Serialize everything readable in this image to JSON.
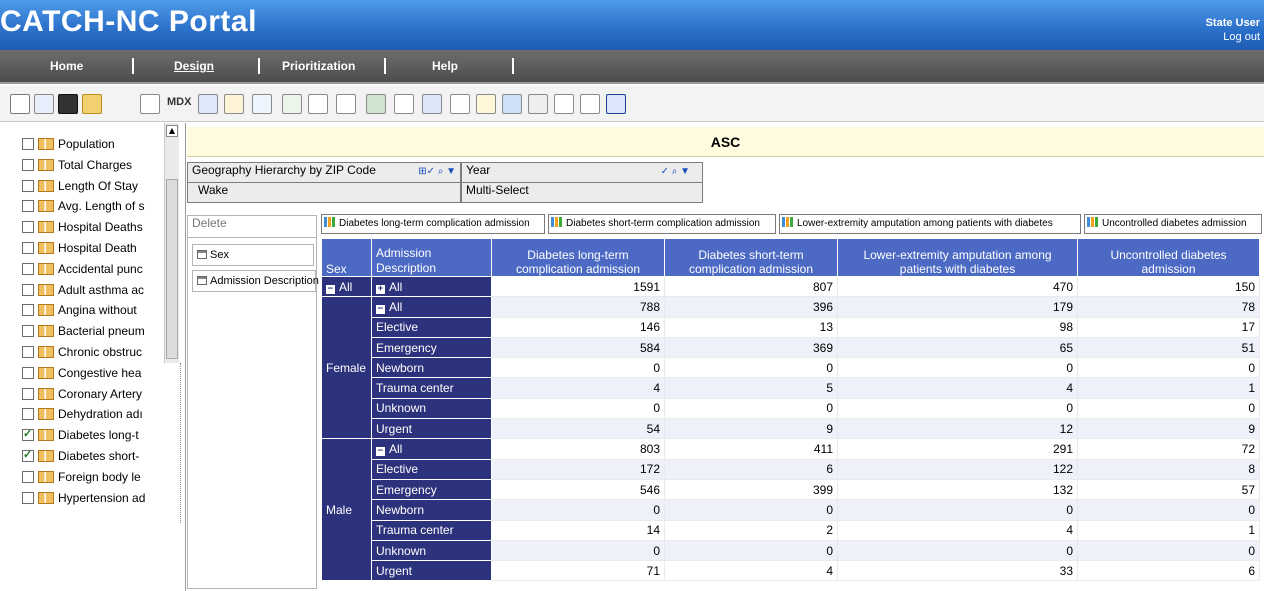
{
  "header": {
    "title": "CATCH-NC Portal",
    "user": "State User",
    "logout": "Log out"
  },
  "nav": {
    "home": "Home",
    "design": "Design",
    "prioritization": "Prioritization",
    "help": "Help"
  },
  "toolbar": {
    "mdx_label": "MDX"
  },
  "sidebar": {
    "items": [
      {
        "label": "Population",
        "checked": false
      },
      {
        "label": "Total Charges",
        "checked": false
      },
      {
        "label": "Length Of Stay",
        "checked": false
      },
      {
        "label": "Avg. Length of s",
        "checked": false
      },
      {
        "label": "Hospital Deaths",
        "checked": false
      },
      {
        "label": "Hospital Death",
        "checked": false
      },
      {
        "label": "Accidental punc",
        "checked": false
      },
      {
        "label": "Adult asthma ac",
        "checked": false
      },
      {
        "label": "Angina without ",
        "checked": false
      },
      {
        "label": "Bacterial pneum",
        "checked": false
      },
      {
        "label": "Chronic obstruc",
        "checked": false
      },
      {
        "label": "Congestive hea",
        "checked": false
      },
      {
        "label": "Coronary Artery",
        "checked": false
      },
      {
        "label": "Dehydration adı",
        "checked": false
      },
      {
        "label": "Diabetes long-t",
        "checked": true
      },
      {
        "label": "Diabetes short-",
        "checked": true
      },
      {
        "label": "Foreign body le",
        "checked": false
      },
      {
        "label": "Hypertension ad",
        "checked": false
      }
    ]
  },
  "main": {
    "heading": "ASC",
    "filters": {
      "geo": {
        "title": "Geography Hierarchy by ZIP Code",
        "value": "Wake"
      },
      "year": {
        "title": "Year",
        "value": "Multi-Select"
      }
    },
    "delete_label": "Delete",
    "row_dims": [
      "Sex",
      "Admission Description"
    ],
    "measures": [
      "Diabetes long-term complication admission",
      "Diabetes short-term complication admission",
      "Lower-extremity amputation among patients with diabetes",
      "Uncontrolled diabetes admission"
    ]
  },
  "pivot": {
    "col_sex": "Sex",
    "col_adm": "Admission Description",
    "headers": [
      "Diabetes long-term complication admission",
      "Diabetes short-term complication admission",
      "Lower-extremity amputation among patients with diabetes",
      "Uncontrolled diabetes admission"
    ],
    "all_label": "All",
    "total": [
      1591,
      807,
      470,
      150
    ],
    "groups": [
      {
        "sex": "Female",
        "rows": [
          {
            "label": "All",
            "values": [
              788,
              396,
              179,
              78
            ]
          },
          {
            "label": "Elective",
            "values": [
              146,
              13,
              98,
              17
            ]
          },
          {
            "label": "Emergency",
            "values": [
              584,
              369,
              65,
              51
            ]
          },
          {
            "label": "Newborn",
            "values": [
              0,
              0,
              0,
              0
            ]
          },
          {
            "label": "Trauma center",
            "values": [
              4,
              5,
              4,
              1
            ]
          },
          {
            "label": "Unknown",
            "values": [
              0,
              0,
              0,
              0
            ]
          },
          {
            "label": "Urgent",
            "values": [
              54,
              9,
              12,
              9
            ]
          }
        ]
      },
      {
        "sex": "Male",
        "rows": [
          {
            "label": "All",
            "values": [
              803,
              411,
              291,
              72
            ]
          },
          {
            "label": "Elective",
            "values": [
              172,
              6,
              122,
              8
            ]
          },
          {
            "label": "Emergency",
            "values": [
              546,
              399,
              132,
              57
            ]
          },
          {
            "label": "Newborn",
            "values": [
              0,
              0,
              0,
              0
            ]
          },
          {
            "label": "Trauma center",
            "values": [
              14,
              2,
              4,
              1
            ]
          },
          {
            "label": "Unknown",
            "values": [
              0,
              0,
              0,
              0
            ]
          },
          {
            "label": "Urgent",
            "values": [
              71,
              4,
              33,
              6
            ]
          }
        ]
      }
    ]
  }
}
